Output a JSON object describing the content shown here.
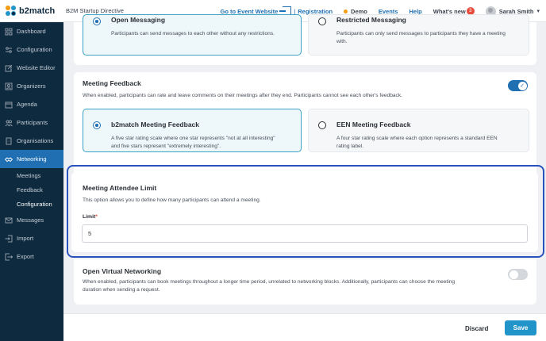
{
  "app": {
    "logo_text": "b2match",
    "event_name": "B2M Startup Directive"
  },
  "topnav": {
    "event_website": "Go to Event Website",
    "registration": "Registration",
    "separator": "|",
    "demo": "Demo",
    "events": "Events",
    "help": "Help",
    "whats_new": "What's new",
    "whats_new_badge": "3",
    "user_name": "Sarah Smith"
  },
  "sidebar": {
    "items": [
      {
        "label": "Dashboard",
        "icon": "grid-icon"
      },
      {
        "label": "Configuration",
        "icon": "sliders-icon"
      },
      {
        "label": "Website Editor",
        "icon": "edit-icon"
      },
      {
        "label": "Organizers",
        "icon": "users-icon"
      },
      {
        "label": "Agenda",
        "icon": "calendar-icon"
      },
      {
        "label": "Participants",
        "icon": "people-icon"
      },
      {
        "label": "Organisations",
        "icon": "building-icon"
      },
      {
        "label": "Networking",
        "icon": "handshake-icon"
      }
    ],
    "sub_items": [
      {
        "label": "Meetings"
      },
      {
        "label": "Feedback"
      },
      {
        "label": "Configuration"
      }
    ],
    "items_after": [
      {
        "label": "Messages",
        "icon": "mail-icon"
      },
      {
        "label": "Import",
        "icon": "import-icon"
      },
      {
        "label": "Export",
        "icon": "export-icon"
      }
    ]
  },
  "messaging": {
    "open": {
      "title": "Open Messaging",
      "desc": "Participants can send messages to each other without any restrictions."
    },
    "restricted": {
      "title": "Restricted Messaging",
      "desc_1": "Participants can only send messages to participants they have a meeting",
      "desc_2": "with."
    }
  },
  "feedback": {
    "title": "Meeting Feedback",
    "desc": "When enabled, participants can rate and leave comments on their meetings after they end. Participants cannot see each other's feedback.",
    "enabled": true,
    "b2match": {
      "title": "b2match Meeting Feedback",
      "desc_1": "A five star rating scale where one star represents \"not at all interesting\"",
      "desc_2": "and five stars represent \"extremely interesting\"."
    },
    "een": {
      "title": "EEN Meeting Feedback",
      "desc_1": "A four star rating scale where each option represents a standard EEN",
      "desc_2": "rating label."
    }
  },
  "attendee_limit": {
    "title": "Meeting Attendee Limit",
    "desc": "This option allows you to define how many participants can attend a meeting.",
    "label": "Limit",
    "required_mark": "*",
    "value": "5"
  },
  "virtual": {
    "title": "Open Virtual Networking",
    "desc_1": "When enabled, participants can book meetings throughout a longer time period, unrelated to networking blocks. Additionally, participants can choose the meeting",
    "desc_2": "duration when sending a request.",
    "enabled": false
  },
  "footer": {
    "discard": "Discard",
    "save": "Save"
  },
  "colors": {
    "sidebar_bg": "#0e2a3f",
    "accent": "#1f6fb2",
    "save_button": "#2194c9",
    "highlight_border": "#2a52be"
  }
}
